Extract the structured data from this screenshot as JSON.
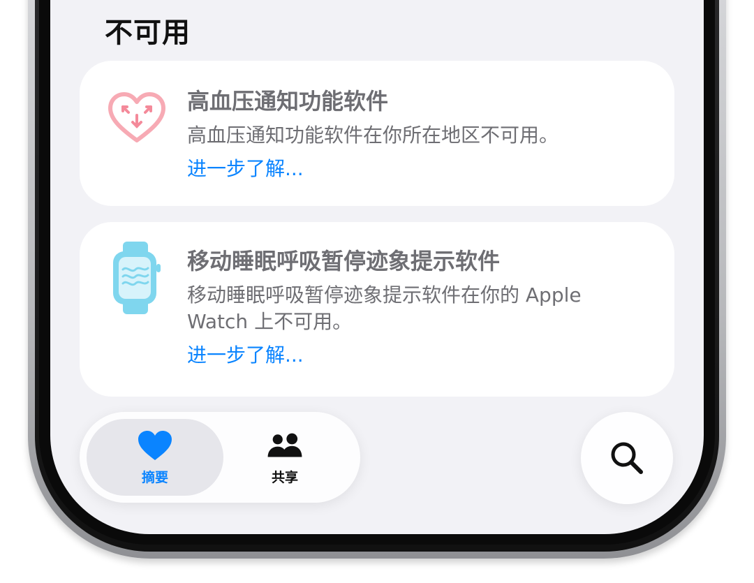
{
  "section": {
    "title": "不可用"
  },
  "cards": [
    {
      "icon": "heart-arrows-icon",
      "title": "高血压通知功能软件",
      "description": "高血压通知功能软件在你所在地区不可用。",
      "link": "进一步了解..."
    },
    {
      "icon": "apple-watch-breathing-icon",
      "title": "移动睡眠呼吸暂停迹象提示软件",
      "description": "移动睡眠呼吸暂停迹象提示软件在你的 Apple Watch 上不可用。",
      "link": "进一步了解..."
    }
  ],
  "tabbar": {
    "tabs": [
      {
        "label": "摘要",
        "icon": "heart-icon",
        "selected": true
      },
      {
        "label": "共享",
        "icon": "people-icon",
        "selected": false
      }
    ]
  },
  "search": {
    "icon": "search-icon"
  },
  "colors": {
    "accent": "#0a84ff",
    "heart_icon": "#f7aab4",
    "watch_icon": "#7fd6ee",
    "background": "#f2f2f6"
  }
}
